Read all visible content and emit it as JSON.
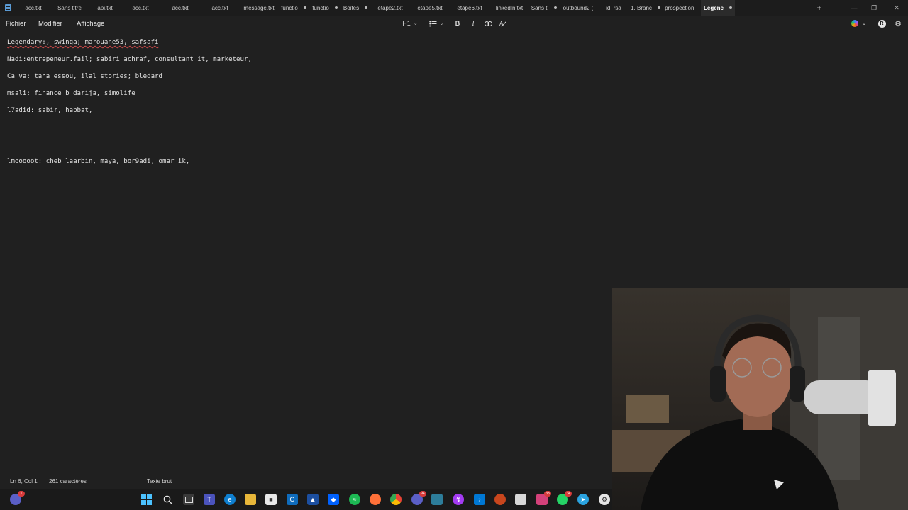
{
  "tabs": [
    {
      "label": "acc.txt",
      "modified": false,
      "active": false
    },
    {
      "label": "Sans titre",
      "modified": false,
      "active": false
    },
    {
      "label": "api.txt",
      "modified": false,
      "active": false
    },
    {
      "label": "acc.txt",
      "modified": false,
      "active": false
    },
    {
      "label": "acc.txt",
      "modified": false,
      "active": false
    },
    {
      "label": "acc.txt",
      "modified": false,
      "active": false
    },
    {
      "label": "message.txt",
      "modified": false,
      "active": false
    },
    {
      "label": "functio",
      "modified": true,
      "active": false
    },
    {
      "label": "functio",
      "modified": true,
      "active": false
    },
    {
      "label": "Boites",
      "modified": true,
      "active": false
    },
    {
      "label": "etape2.txt",
      "modified": false,
      "active": false
    },
    {
      "label": "etape5.txt",
      "modified": false,
      "active": false
    },
    {
      "label": "etape6.txt",
      "modified": false,
      "active": false
    },
    {
      "label": "linkedIn.txt",
      "modified": false,
      "active": false
    },
    {
      "label": "Sans ti",
      "modified": true,
      "active": false
    },
    {
      "label": "outbound2 (",
      "modified": false,
      "active": false
    },
    {
      "label": "id_rsa",
      "modified": false,
      "active": false
    },
    {
      "label": "1. Branc",
      "modified": true,
      "active": false
    },
    {
      "label": "prospection_",
      "modified": false,
      "active": false
    },
    {
      "label": "Legenc",
      "modified": true,
      "active": true
    }
  ],
  "add_tab_label": "+",
  "menu": {
    "file": "Fichier",
    "edit": "Modifier",
    "view": "Affichage"
  },
  "toolbar": {
    "heading": "H1",
    "bold": "B",
    "italic": "I"
  },
  "account_initial": "R",
  "editor": {
    "lines": [
      "Legendary:, swinga; marouane53, safsafi",
      "Nadi:entrepeneur.fail; sabiri achraf, consultant it, marketeur,",
      "Ca va: taha essou, ilal stories; bledard",
      "msali: finance_b_darija, simolife",
      "l7adid: sabir, habbat,",
      "lmooooot: cheb laarbin, maya, bor9adi, omar ik,"
    ]
  },
  "status": {
    "position": "Ln 6, Col 1",
    "chars": "261 caractères",
    "format": "Texte brut"
  },
  "taskbar": {
    "badge_first": "1",
    "badge_teams": "9+",
    "badge_app": "33",
    "badge_whatsapp": "74"
  },
  "colors": {
    "background": "#202020",
    "tabbar": "#1c1c1c",
    "spellcheck": "#d04a4a"
  }
}
